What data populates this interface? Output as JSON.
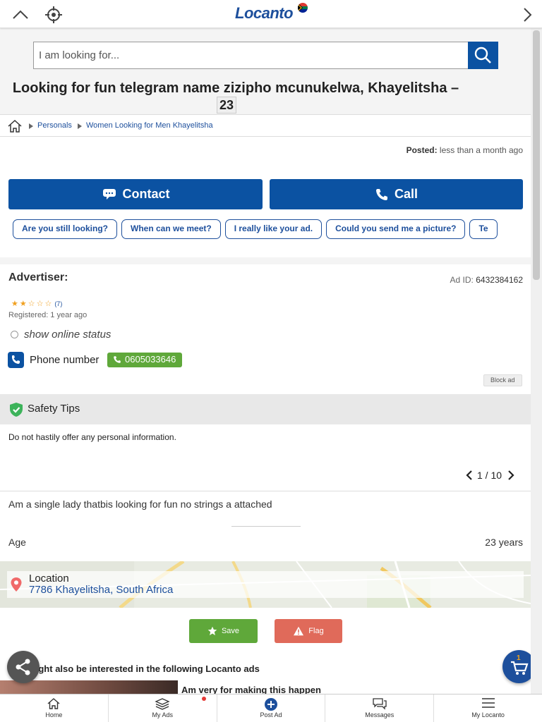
{
  "topbar": {
    "logo_text": "Locanto"
  },
  "search": {
    "placeholder": "I am looking for..."
  },
  "listing": {
    "title": "Looking for fun telegram name zizipho mcunukelwa, Khayelitsha –",
    "title_age": "23",
    "posted_label": "Posted:",
    "posted_value": "less than a month ago",
    "description": "Am a single lady thatbis looking for fun no strings a attached",
    "age_label": "Age",
    "age_value": "23 years",
    "pager": "1 / 10"
  },
  "breadcrumb": {
    "items": [
      "Personals",
      "Women Looking for Men Khayelitsha"
    ]
  },
  "actions": {
    "contact": "Contact",
    "call": "Call"
  },
  "quick_messages": [
    "Are you still looking?",
    "When can we meet?",
    "I really like your ad.",
    "Could you send me a picture?",
    "Te"
  ],
  "advertiser": {
    "heading": "Advertiser:",
    "ad_id_label": "Ad ID:",
    "ad_id": "6432384162",
    "rating": 2,
    "rating_max": 5,
    "rating_count": "(7)",
    "registered": "Registered: 1 year ago",
    "online_status": "show online status",
    "phone_label": "Phone number",
    "phone_number": "0605033646",
    "block_label": "Block ad"
  },
  "safety": {
    "heading": "Safety Tips",
    "tip": "Do not hastily offer any personal information."
  },
  "location": {
    "label": "Location",
    "value": "7786 Khayelitsha, South Africa"
  },
  "buttons": {
    "save": "Save",
    "flag": "Flag"
  },
  "related": {
    "heading": "You might also be interested in the following Locanto ads",
    "first_title": "Am very for making this happen"
  },
  "cart": {
    "count": "1"
  },
  "bottom_nav": [
    "Home",
    "My Ads",
    "Post Ad",
    "Messages",
    "My Locanto"
  ],
  "colors": {
    "brand_blue": "#0b52a2",
    "green": "#5fa83a",
    "flag_red": "#e06a5a",
    "star": "#f0a020"
  }
}
